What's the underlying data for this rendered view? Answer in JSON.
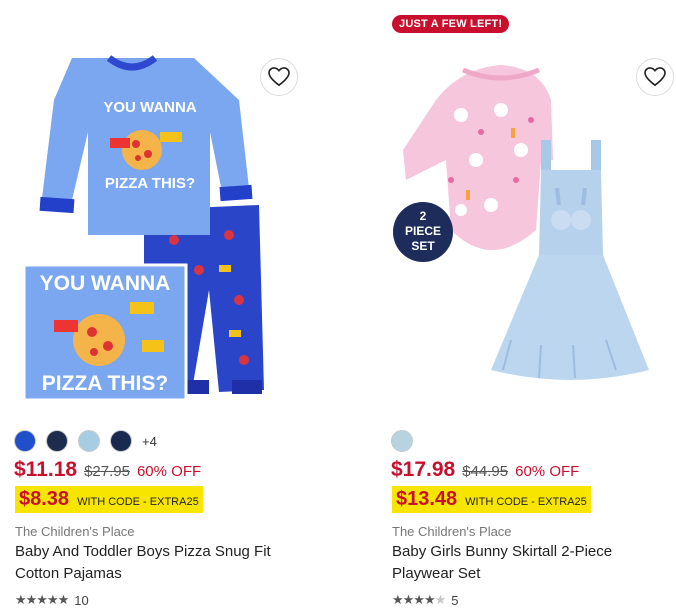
{
  "products": [
    {
      "swatches": [
        "#1f4fc9",
        "#1d2c4d",
        "#a6cde3",
        "#1a2950"
      ],
      "swatch_more": "+4",
      "price": "$11.18",
      "original_price": "$27.95",
      "discount": "60% OFF",
      "code_price": "$8.38",
      "code_text": "WITH CODE - EXTRA25",
      "brand": "The Children's Place",
      "title": "Baby And Toddler Boys Pizza Snug Fit Cotton Pajamas",
      "rating": 4.8,
      "review_count": "10",
      "image_text": [
        "YOU WANNA",
        "PIZZA THIS?"
      ]
    },
    {
      "badge": "JUST A FEW LEFT!",
      "swatches": [
        "#b7d3df"
      ],
      "price": "$17.98",
      "original_price": "$44.95",
      "discount": "60% OFF",
      "code_price": "$13.48",
      "code_text": "WITH CODE - EXTRA25",
      "brand": "The Children's Place",
      "title": "Baby Girls Bunny Skirtall 2-Piece Playwear Set",
      "rating": 4.5,
      "review_count": "5",
      "image_badge": [
        "2",
        "PIECE",
        "SET"
      ]
    }
  ],
  "colors": {
    "sale_red": "#c8102e",
    "code_yellow": "#f7e500"
  }
}
